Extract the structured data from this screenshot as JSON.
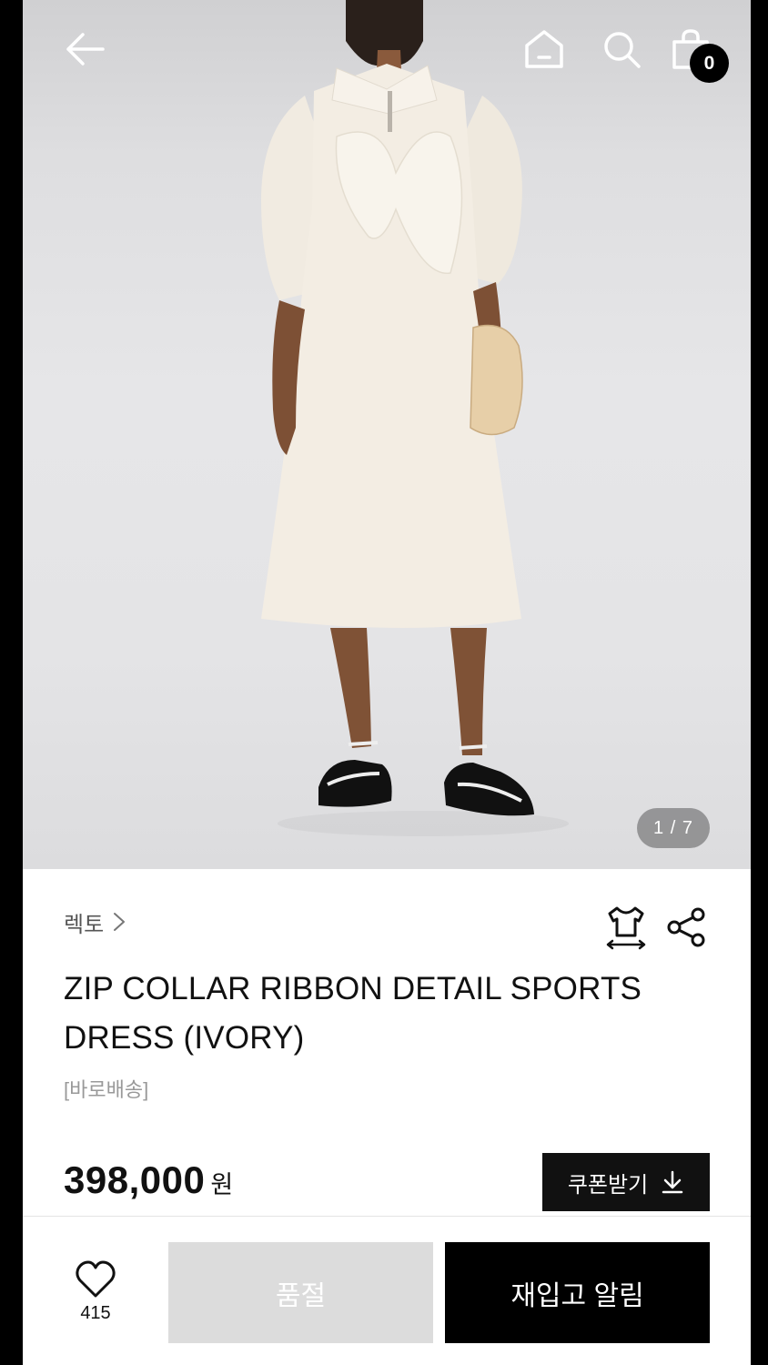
{
  "header": {
    "cart_count": "0",
    "icons": [
      "back-arrow-icon",
      "home-icon",
      "search-icon",
      "shopping-bag-icon"
    ]
  },
  "gallery": {
    "counter": "1 / 7"
  },
  "product": {
    "brand": "렉토",
    "title": "ZIP COLLAR RIBBON DETAIL SPORTS DRESS (IVORY)",
    "delivery_tag": "[바로배송]",
    "price": "398,000",
    "currency": "원",
    "coupon_label": "쿠폰받기"
  },
  "actions": {
    "like_count": "415",
    "soldout_label": "품절",
    "restock_label": "재입고 알림"
  },
  "colors": {
    "accent": "#000000",
    "disabled": "#dcdcdc"
  }
}
